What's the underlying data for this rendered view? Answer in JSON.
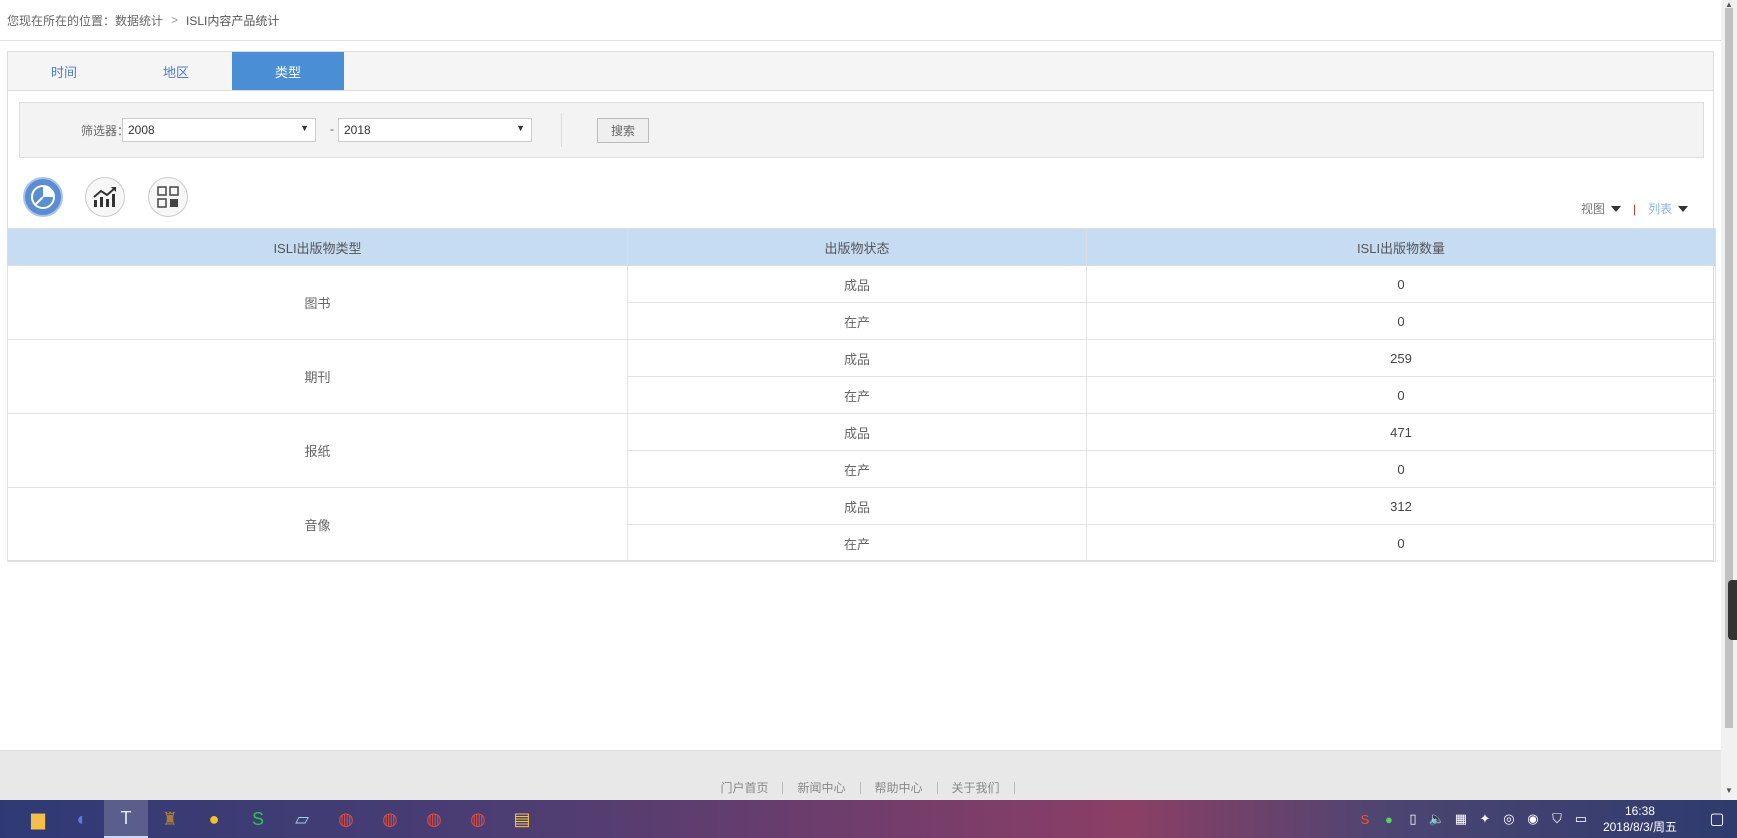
{
  "breadcrumb": {
    "prefix": "您现在所在的位置：",
    "items": [
      "数据统计",
      "ISLI内容产品统计"
    ],
    "separator": ">"
  },
  "tabs": [
    {
      "label": "时间",
      "active": false
    },
    {
      "label": "地区",
      "active": false
    },
    {
      "label": "类型",
      "active": true
    }
  ],
  "filter": {
    "label": "筛选器：",
    "from_year": "2008",
    "to_year": "2018",
    "dash": "-",
    "search_label": "搜索"
  },
  "view_icons": [
    "pie-chart-icon",
    "trend-chart-icon",
    "grid-icon"
  ],
  "view_toggle": {
    "view_label": "视图",
    "list_label": "列表",
    "sep": "|",
    "view_color": "#777777",
    "list_color": "#8ab4e8",
    "sep_color": "#c0392b"
  },
  "table": {
    "headers": [
      "ISLI出版物类型",
      "出版物状态",
      "ISLI出版物数量"
    ],
    "groups": [
      {
        "type": "图书",
        "rows": [
          {
            "status": "成品",
            "count": "0"
          },
          {
            "status": "在产",
            "count": "0"
          }
        ]
      },
      {
        "type": "期刊",
        "rows": [
          {
            "status": "成品",
            "count": "259"
          },
          {
            "status": "在产",
            "count": "0"
          }
        ]
      },
      {
        "type": "报纸",
        "rows": [
          {
            "status": "成品",
            "count": "471"
          },
          {
            "status": "在产",
            "count": "0"
          }
        ]
      },
      {
        "type": "音像",
        "rows": [
          {
            "status": "成品",
            "count": "312"
          },
          {
            "status": "在产",
            "count": "0"
          }
        ]
      }
    ]
  },
  "footer": {
    "links": [
      "门户首页",
      "新闻中心",
      "帮助中心",
      "关于我们"
    ]
  },
  "taskbar": {
    "apps": [
      "file-explorer-icon",
      "browser-icon",
      "text-editor-icon",
      "game-icon",
      "duck-icon",
      "spreadsheet-icon",
      "notepad-icon",
      "chrome-icon",
      "chrome-icon",
      "chrome-icon",
      "chrome-icon",
      "calendar-app-icon"
    ],
    "clock_time": "16:38",
    "clock_date": "2018/8/3/周五",
    "accent_color": "#4a8fd6"
  }
}
